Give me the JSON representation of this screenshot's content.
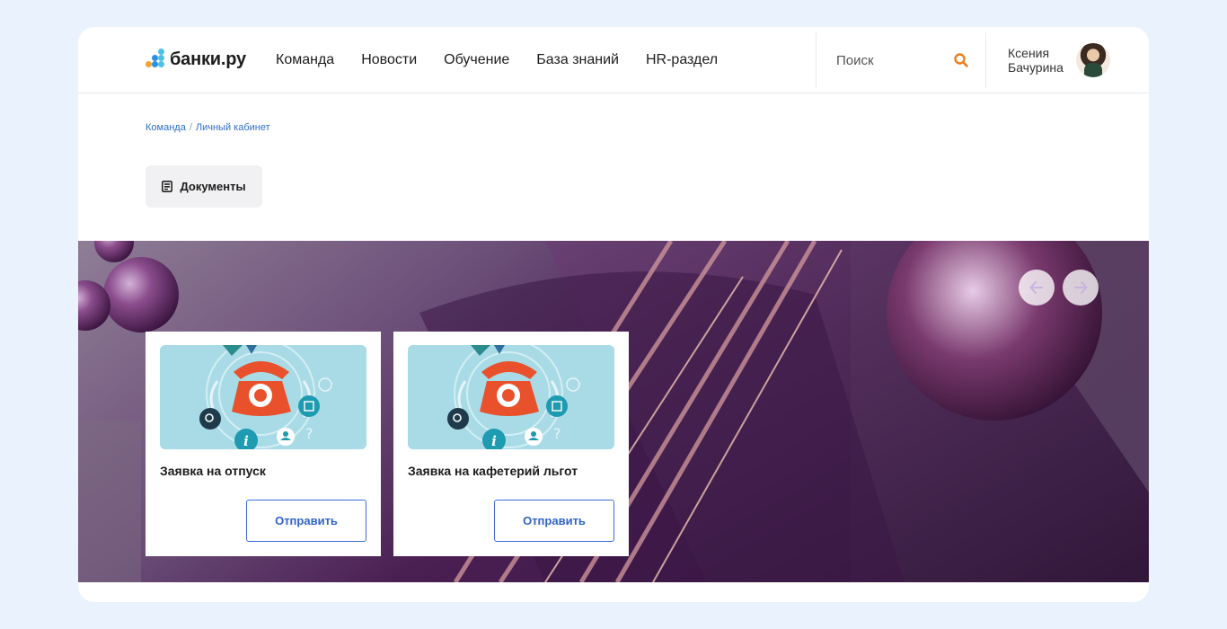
{
  "header": {
    "logo_text": "банки.ру",
    "nav": [
      {
        "label": "Команда"
      },
      {
        "label": "Новости"
      },
      {
        "label": "Обучение"
      },
      {
        "label": "База знаний"
      },
      {
        "label": "HR-раздел"
      }
    ],
    "search": {
      "placeholder": "Поиск",
      "value": ""
    },
    "user": {
      "name": "Ксения Бачурина"
    }
  },
  "breadcrumb": {
    "items": [
      "Команда",
      "Личный кабинет"
    ],
    "separator": "/"
  },
  "documents_button": {
    "label": "Документы"
  },
  "carousel": {
    "cards": [
      {
        "title": "Заявка на отпуск",
        "button_label": "Отправить"
      },
      {
        "title": "Заявка на кафетерий льгот",
        "button_label": "Отправить"
      }
    ]
  },
  "colors": {
    "page_bg": "#eaf3fd",
    "accent_blue": "#2f63c8",
    "search_icon": "#f07d1a",
    "hero_purple": "#4a1f52",
    "card_illustration_bg": "#a9dbe6",
    "phone_red": "#e8512c"
  },
  "icons": [
    "search-icon",
    "document-icon",
    "arrow-left-icon",
    "arrow-right-icon"
  ]
}
